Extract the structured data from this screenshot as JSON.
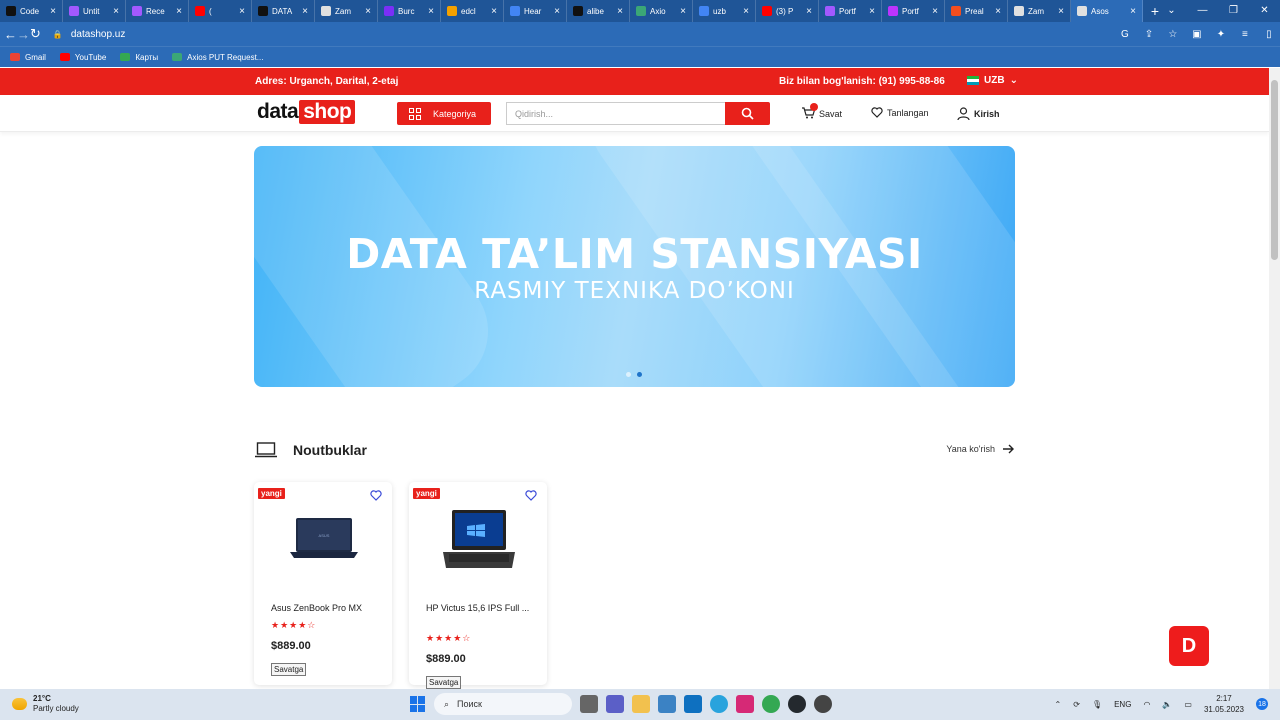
{
  "browser": {
    "tabs": [
      {
        "title": "Code",
        "icon": "codepen-icon",
        "color": "#111111"
      },
      {
        "title": "Untit",
        "icon": "figma-icon",
        "color": "#a259ff"
      },
      {
        "title": "Rece",
        "icon": "figma-icon",
        "color": "#a259ff"
      },
      {
        "title": "(",
        "icon": "youtube-icon",
        "color": "#ff0000"
      },
      {
        "title": "DATA",
        "icon": "github-icon",
        "color": "#111111"
      },
      {
        "title": "Zam",
        "icon": "globe-icon",
        "color": "#e0e0e0"
      },
      {
        "title": "Burc",
        "icon": "circle-icon",
        "color": "#7b2ff7"
      },
      {
        "title": "edcl",
        "icon": "hand-icon",
        "color": "#f4a100"
      },
      {
        "title": "Hear",
        "icon": "flag-icon",
        "color": "#4285f4"
      },
      {
        "title": "alibe",
        "icon": "github-icon",
        "color": "#111111"
      },
      {
        "title": "Axio",
        "icon": "postman-icon",
        "color": "#3ba776"
      },
      {
        "title": "uzb",
        "icon": "google-icon",
        "color": "#4285f4"
      },
      {
        "title": "(3) P",
        "icon": "youtube-icon",
        "color": "#ff0000"
      },
      {
        "title": "Portf",
        "icon": "figma-icon",
        "color": "#a259ff"
      },
      {
        "title": "Portf",
        "icon": "vite-icon",
        "color": "#bd34fe"
      },
      {
        "title": "Preal",
        "icon": "figma-icon",
        "color": "#f24e1e"
      },
      {
        "title": "Zam",
        "icon": "globe-icon",
        "color": "#e0e0e0"
      },
      {
        "title": "Asos",
        "icon": "globe-icon",
        "color": "#e0e0e0",
        "active": true
      }
    ],
    "new_tab": "+",
    "url": "datashop.uz",
    "bookmarks": [
      {
        "label": "Gmail",
        "color": "#ea4335"
      },
      {
        "label": "YouTube",
        "color": "#ff0000"
      },
      {
        "label": "Карты",
        "color": "#34a853"
      },
      {
        "label": "Axios PUT Request...",
        "color": "#3ba776"
      }
    ]
  },
  "site": {
    "topbar": {
      "address": "Adres: Urganch, Darital, 2-etaj",
      "contact": "Biz bilan bog'lanish: (91) 995-88-86",
      "language": "UZB"
    },
    "header": {
      "logo_a": "data",
      "logo_b": "shop",
      "category_button": "Kategoriya",
      "search_placeholder": "Qidirish...",
      "cart_label": "Savat",
      "favorites_label": "Tanlangan",
      "login_label": "Kirish"
    },
    "banner": {
      "title": "DATA TA’LIM STANSIYASI",
      "subtitle": "RASMIY TEXNIKA DO’KONI",
      "active_slide": 2,
      "slide_count": 2
    },
    "section": {
      "title": "Noutbuklar",
      "more_link": "Yana ko'rish"
    },
    "products": [
      {
        "badge": "yangi",
        "name": "Asus ZenBook Pro MX",
        "rating": 4,
        "price": "$889.00",
        "cart_button": "Savatga"
      },
      {
        "badge": "yangi",
        "name": "HP Victus 15,6 IPS Full ...",
        "rating": 4,
        "price": "$889.00",
        "cart_button": "Savatga"
      }
    ],
    "floating_badge": "D"
  },
  "taskbar": {
    "weather_temp": "21°C",
    "weather_desc": "Partly cloudy",
    "search_label": "Поиск",
    "language": "ENG",
    "time": "2:17",
    "date": "31.05.2023",
    "notifications": "18"
  },
  "colors": {
    "brand_red": "#e8211b",
    "chrome_blue": "#2c6bb7"
  }
}
